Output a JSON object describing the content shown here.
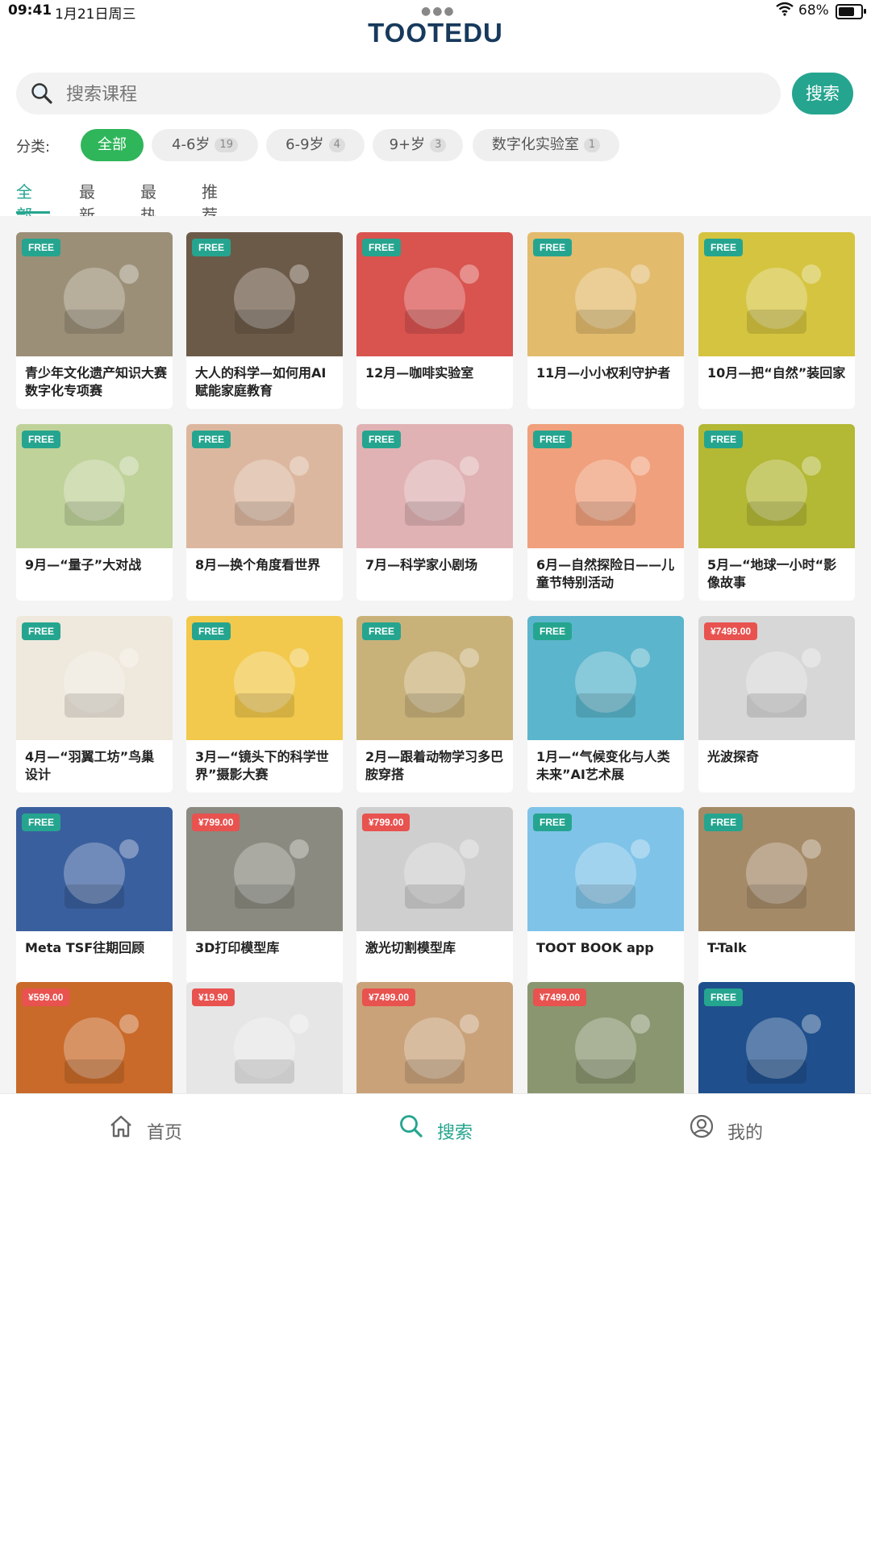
{
  "status_bar": {
    "time": "09:41",
    "date": "1月21日周三",
    "battery": "68%"
  },
  "app": {
    "title": "TOOTEDU"
  },
  "search": {
    "placeholder": "搜索课程",
    "button": "搜索"
  },
  "categories": {
    "label": "分类:",
    "items": [
      {
        "label": "全部",
        "count": "",
        "active": true
      },
      {
        "label": "4-6岁",
        "count": "19",
        "active": false
      },
      {
        "label": "6-9岁",
        "count": "4",
        "active": false
      },
      {
        "label": "9+岁",
        "count": "3",
        "active": false
      },
      {
        "label": "数字化实验室",
        "count": "1",
        "active": false
      }
    ]
  },
  "tabs": [
    {
      "label": "全部",
      "active": true
    },
    {
      "label": "最新",
      "active": false
    },
    {
      "label": "最热",
      "active": false
    },
    {
      "label": "推荐",
      "active": false
    }
  ],
  "courses": [
    {
      "badge": "FREE",
      "title": "青少年文化遗产知识大赛数字化专项赛",
      "bg": "#9b8f77",
      "icon": "mural-painting"
    },
    {
      "badge": "FREE",
      "title": "大人的科学—如何用AI赋能家庭教育",
      "bg": "#6c5a48",
      "icon": "laptop-typing"
    },
    {
      "badge": "FREE",
      "title": "12月—咖啡实验室",
      "bg": "#d9534f",
      "icon": "coffee-cup"
    },
    {
      "badge": "FREE",
      "title": "11月—小小权利守护者",
      "bg": "#e2bb6d",
      "icon": "handshake"
    },
    {
      "badge": "FREE",
      "title": "10月—把“自然”装回家",
      "bg": "#d5c43f",
      "icon": "flask-terrarium"
    },
    {
      "badge": "FREE",
      "title": "9月—“量子”大对战",
      "bg": "#bfd29a",
      "icon": "quantum-orbit"
    },
    {
      "badge": "FREE",
      "title": "8月—换个角度看世界",
      "bg": "#dcb79f",
      "icon": "microscope"
    },
    {
      "badge": "FREE",
      "title": "7月—科学家小剧场",
      "bg": "#e0b2b4",
      "icon": "kids-theater"
    },
    {
      "badge": "FREE",
      "title": "6月—自然探险日——儿童节特别活动",
      "bg": "#f0a07c",
      "icon": "tree-magnifier"
    },
    {
      "badge": "FREE",
      "title": "5月—“地球一小时“影像故事",
      "bg": "#b3b835",
      "icon": "earth-globe"
    },
    {
      "badge": "FREE",
      "title": "4月—“羽翼工坊”鸟巢设计",
      "bg": "#efe8dc",
      "icon": "birdhouse"
    },
    {
      "badge": "FREE",
      "title": "3月—“镜头下的科学世界”摄影大赛",
      "bg": "#f2c94c",
      "icon": "camera-photos"
    },
    {
      "badge": "FREE",
      "title": "2月—跟着动物学习多巴胺穿搭",
      "bg": "#c9b27a",
      "icon": "colorful-birds"
    },
    {
      "badge": "FREE",
      "title": "1月—“气候变化与人类未来”AI艺术展",
      "bg": "#5bb5cc",
      "icon": "recycle-drop"
    },
    {
      "badge": "¥7499.00",
      "title": "光波探奇",
      "bg": "#d7d7d7",
      "icon": "light-bottles"
    },
    {
      "badge": "FREE",
      "title": "Meta TSF往期回顾",
      "bg": "#3a5f9e",
      "icon": "kids-photo"
    },
    {
      "badge": "¥799.00",
      "title": "3D打印模型库",
      "bg": "#8a8a80",
      "icon": "3d-printer"
    },
    {
      "badge": "¥799.00",
      "title": "激光切割模型库",
      "bg": "#cfcfcf",
      "icon": "laser-kids"
    },
    {
      "badge": "FREE",
      "title": "TOOT BOOK app",
      "bg": "#7fc3e8",
      "icon": "welcome-world"
    },
    {
      "badge": "FREE",
      "title": "T-Talk",
      "bg": "#a58a68",
      "icon": "t-talk-monsters"
    },
    {
      "badge": "¥599.00",
      "title": "",
      "bg": "#c96a2a",
      "icon": "autumn-scene"
    },
    {
      "badge": "¥19.90",
      "title": "",
      "bg": "#e6e6e6",
      "icon": "dinosaur-skeletons"
    },
    {
      "badge": "¥7499.00",
      "title": "",
      "bg": "#c9a27a",
      "icon": "flower-garden"
    },
    {
      "badge": "¥7499.00",
      "title": "",
      "bg": "#8a9670",
      "icon": "forest-path"
    },
    {
      "badge": "FREE",
      "title": "",
      "bg": "#1f4f8c",
      "icon": "eye-optics"
    }
  ],
  "bottom_nav": [
    {
      "label": "首页",
      "icon": "home-icon",
      "active": false
    },
    {
      "label": "搜索",
      "icon": "search-icon",
      "active": true
    },
    {
      "label": "我的",
      "icon": "profile-icon",
      "active": false
    }
  ]
}
